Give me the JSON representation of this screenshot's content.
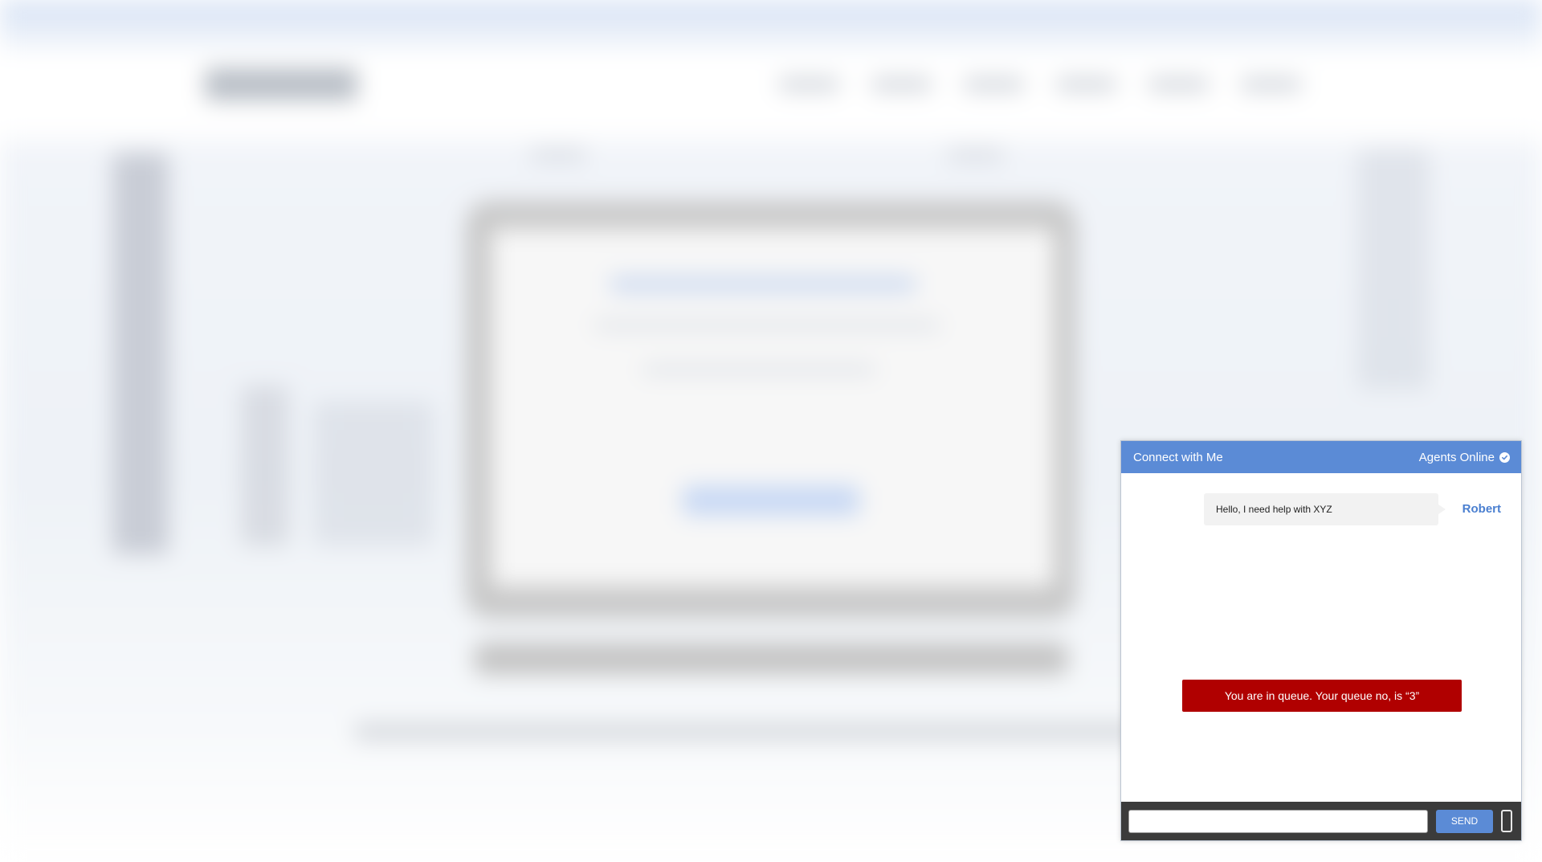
{
  "chat": {
    "title": "Connect with Me",
    "status": "Agents Online",
    "status_icon": "check-circle-icon",
    "message": {
      "text": "Hello, I need help with XYZ",
      "sender": "Robert"
    },
    "queue_notice": "You are in queue. Your queue no, is “3”",
    "input_placeholder": "",
    "send_label": "SEND",
    "device_icon": "mobile-phone-icon"
  },
  "colors": {
    "header": "#5b8bd6",
    "queue_banner": "#b00000",
    "footer": "#3b3b3b",
    "sender_name": "#4a7fd0"
  }
}
